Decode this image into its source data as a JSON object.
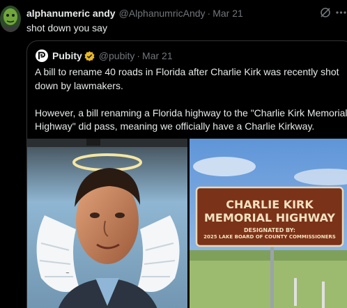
{
  "post": {
    "author_name": "alphanumeric andy",
    "author_handle": "@AlphanumricAndy",
    "separator": "·",
    "time": "Mar 21",
    "text": "shot down you say"
  },
  "quote": {
    "author_name": "Pubity",
    "author_handle": "@pubity",
    "separator": "·",
    "time": "Mar 21",
    "paragraph_1": "A bill to rename 40 roads in Florida after Charlie Kirk was recently shot down by lawmakers.",
    "paragraph_2": "However, a bill renaming a Florida highway to the \"Charlie Kirk Memorial Highway\" did pass, meaning we officially have a Charlie Kirkway."
  },
  "sign": {
    "line_1": "CHARLIE KIRK",
    "line_2": "MEMORIAL HIGHWAY",
    "line_3": "DESIGNATED BY:",
    "line_4": "2025 LAKE BOARD OF COUNTY COMMISSIONERS"
  },
  "colors": {
    "background": "#000000",
    "text_primary": "#e7e9ea",
    "text_secondary": "#71767b",
    "border": "#2f3336",
    "verified_gold": "#e8b923"
  },
  "icons": {
    "grok": "grok-icon",
    "more": "more-icon",
    "verified": "verified-badge-icon",
    "pubity_logo": "pubity-logo"
  }
}
